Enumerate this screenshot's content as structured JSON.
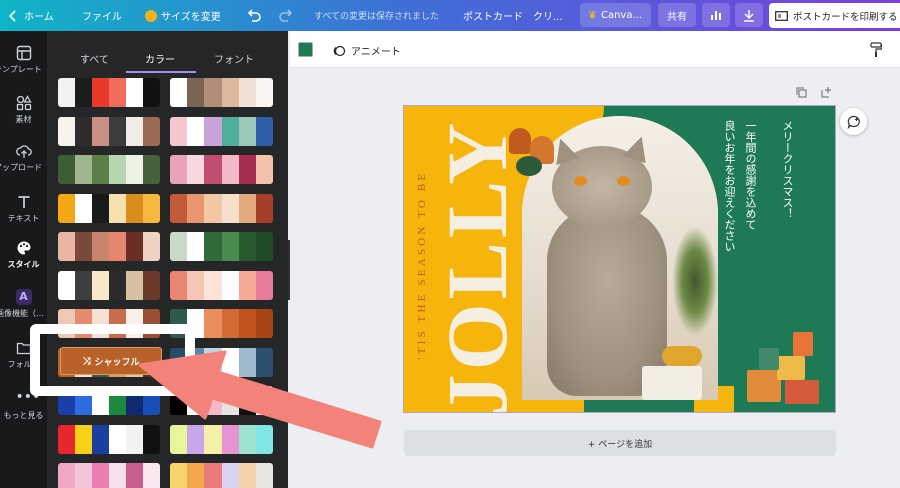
{
  "topbar": {
    "home": "ホーム",
    "file": "ファイル",
    "resize": "サイズを変更",
    "saved_status": "すべての変更は保存されました",
    "doc_title": "ポストカード　クリ...",
    "canva_pro": "Canva...",
    "share": "共有",
    "print": "ポストカードを印刷する"
  },
  "rail": {
    "items": [
      "テンプレート",
      "素材",
      "アップロード",
      "テキスト",
      "スタイル",
      "画像機能（…",
      "フォルダ",
      "もっと見る"
    ]
  },
  "panel": {
    "tabs": [
      "すべて",
      "カラー",
      "フォント"
    ],
    "active_tab": "カラー",
    "shuffle_label": "シャッフル",
    "palettes_left": [
      [
        "#f2f2f2",
        "#1c1c1c",
        "#e8392b",
        "#f26b5b",
        "#ffffff",
        "#111111"
      ],
      [
        "#f5f3ec",
        "#2d2d2d",
        "#c98f84",
        "#3d3d3d",
        "#f0ede6",
        "#9a6a55"
      ],
      [
        "#3d5e34",
        "#9fb58e",
        "#5c7f4a",
        "#b9d4b0",
        "#eef3e6",
        "#46623b"
      ],
      [
        "#f3a712",
        "#ffffff",
        "#1a1a1a",
        "#f7e1b0",
        "#d98e1c",
        "#f6b93b"
      ],
      [
        "#e9b6a3",
        "#7b4a3a",
        "#c7836e",
        "#e5876f",
        "#6a2f24",
        "#f0d2c5"
      ],
      [
        "#ffffff",
        "#3e3e3e",
        "#f7e7c6",
        "#2b2b2b",
        "#d8c1a0",
        "#6a3b2b"
      ],
      [
        "#f0c7b2",
        "#e58a6f",
        "#f7e1d3",
        "#c76c4c",
        "#faf0ea",
        "#9a4f35"
      ],
      [
        "#b8622a",
        "#f2e2c4",
        "#3b5b47",
        "#d7a05a",
        "#e9c9a0",
        "#5a2c1a"
      ],
      [
        "#1b3fa8",
        "#2d6cdf",
        "#ffffff",
        "#1b8a3f",
        "#0f2a6e",
        "#174fb8"
      ],
      [
        "#e8262b",
        "#f7d116",
        "#1a3fa0",
        "#ffffff",
        "#f2f2f2",
        "#111111"
      ],
      [
        "#f0a7c4",
        "#f2c6d9",
        "#e97fb0",
        "#f7dfe9",
        "#c85d90",
        "#fbe7f0"
      ]
    ],
    "palettes_right": [
      [
        "#ffffff",
        "#7b6455",
        "#b08e77",
        "#d9b89e",
        "#efe2d4",
        "#f8f4ef"
      ],
      [
        "#f5c6d0",
        "#ffffff",
        "#c8a3d8",
        "#4fae9a",
        "#9cc9b7",
        "#2f5fa8"
      ],
      [
        "#e8a3b8",
        "#f7d7e0",
        "#c04e6e",
        "#f4b9c6",
        "#a52e52",
        "#f2c2aa"
      ],
      [
        "#c45a3c",
        "#e9956e",
        "#f3c6a5",
        "#f6e0cb",
        "#e2aa7e",
        "#a63f2a"
      ],
      [
        "#c9d8c8",
        "#ffffff",
        "#2f6b3a",
        "#4a8b4f",
        "#2a5a32",
        "#1f4c26"
      ],
      [
        "#e98673",
        "#f6c6b4",
        "#fde3d7",
        "#ffffff",
        "#f7a996",
        "#e87a9a"
      ],
      [
        "#2e5a49",
        "#ffffff",
        "#e78e5b",
        "#d36a35",
        "#c1531f",
        "#a84415"
      ],
      [
        "#264b6b",
        "#5a86a8",
        "#c2d4e0",
        "#ffffff",
        "#9fb8cc",
        "#2e4f6e"
      ],
      [
        "#000000",
        "#ffffff",
        "#f7b8c8",
        "#e4e4e4",
        "#0f0f0f",
        "#f0f0f0"
      ],
      [
        "#e8f59a",
        "#c7a7ea",
        "#f4f0a8",
        "#e693d4",
        "#9be3cf",
        "#7fe6e8"
      ],
      [
        "#f7d36b",
        "#f3a74a",
        "#e97b7b",
        "#d9d4f2",
        "#f5d0a9",
        "#e7e5e0"
      ]
    ]
  },
  "editor": {
    "color_swatch": "#1d7a55",
    "animate_label": "アニメート",
    "add_page": "+ ページを追加"
  },
  "card": {
    "tagline": "'TIS THE SEASON TO BE",
    "title": "JOLLY",
    "jp_line1": "メリークリスマス！",
    "jp_line2": "一年間の感謝を込めて",
    "jp_line3": "良いお年をお迎えください",
    "colors": {
      "yellow": "#f6b50d",
      "green": "#1d7a55",
      "cream": "#f4efe0",
      "orange_text": "#c45a16"
    }
  }
}
